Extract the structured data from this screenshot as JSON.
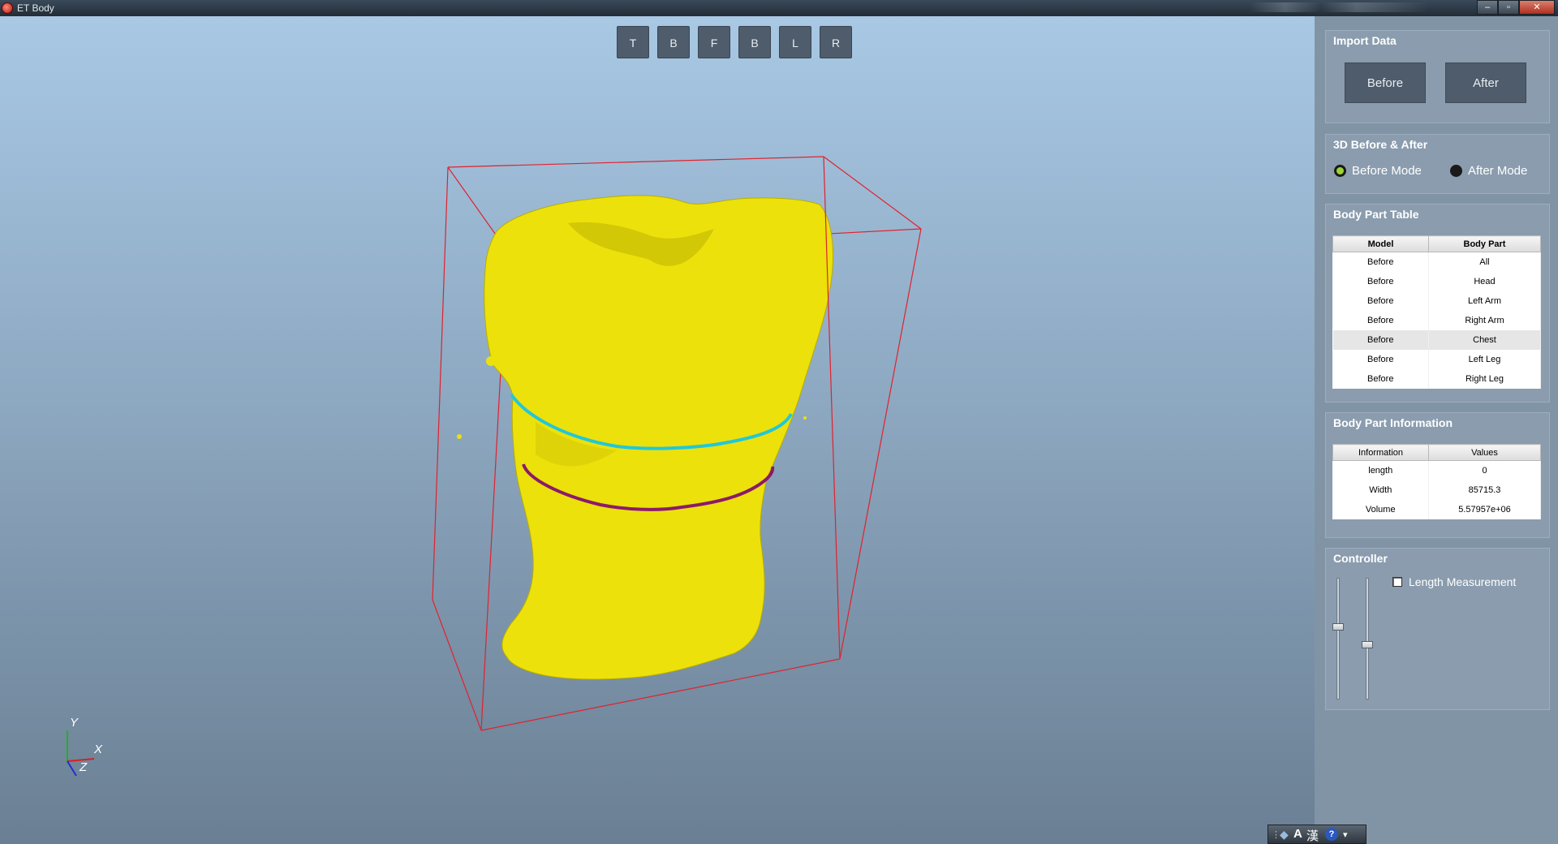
{
  "window": {
    "title": "ET Body",
    "minimize": "–",
    "maximize": "▫",
    "close": "✕"
  },
  "view_buttons": [
    "T",
    "B",
    "F",
    "B",
    "L",
    "R"
  ],
  "axes": {
    "y": "Y",
    "x": "X",
    "z": "Z"
  },
  "colors": {
    "model": "#ece10a",
    "bounding_box": "#e0222e",
    "upper_ring": "#22c7d8",
    "lower_ring": "#8b1a6a",
    "axis_x": "#d62020",
    "axis_y": "#22b022",
    "axis_z": "#2030d0"
  },
  "import_data": {
    "title": "Import Data",
    "before": "Before",
    "after": "After"
  },
  "mode": {
    "title": "3D Before & After",
    "before": "Before Mode",
    "after": "After Mode",
    "selected": "Before Mode"
  },
  "body_part_table": {
    "title": "Body Part Table",
    "headers": [
      "Model",
      "Body Part"
    ],
    "rows": [
      [
        "Before",
        "All"
      ],
      [
        "Before",
        "Head"
      ],
      [
        "Before",
        "Left Arm"
      ],
      [
        "Before",
        "Right Arm"
      ],
      [
        "Before",
        "Chest"
      ],
      [
        "Before",
        "Left Leg"
      ],
      [
        "Before",
        "Right Leg"
      ]
    ],
    "selected_row": 4
  },
  "body_part_info": {
    "title": "Body Part Information",
    "headers": [
      "Information",
      "Values"
    ],
    "rows": [
      [
        "length",
        "0"
      ],
      [
        "Width",
        "85715.3"
      ],
      [
        "Volume",
        "5.57957e+06"
      ]
    ]
  },
  "controller": {
    "title": "Controller",
    "length_measurement": "Length Measurement",
    "length_measurement_checked": false,
    "slider1_level": 0.6,
    "slider2_level": 0.45
  },
  "ime": {
    "a": "A",
    "han": "漢",
    "help": "?"
  }
}
